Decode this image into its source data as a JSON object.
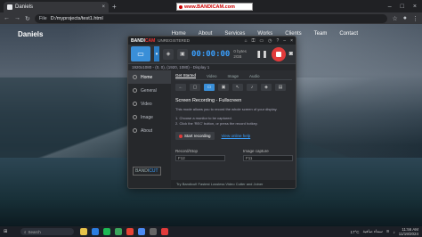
{
  "browser": {
    "tab_title": "Daniels",
    "tab_close": "×",
    "new_tab": "+",
    "window_controls": [
      "–",
      "□",
      "×"
    ],
    "address_scheme": "File",
    "address_path": "D:/myprojects/test1.html"
  },
  "website": {
    "brand": "Daniels",
    "nav": [
      "Home",
      "About",
      "Services",
      "Works",
      "Clients",
      "Team",
      "Contact"
    ]
  },
  "bandicam_banner": {
    "text": "www.BANDICAM.com"
  },
  "bandicam": {
    "logo_a": "BANDI",
    "logo_b": "CAM",
    "subtitle": "UNREGISTERED",
    "timer": "00:00:00",
    "size_value": "0 bytes",
    "size_total": "2GB",
    "info": "1920x1080 - (0, 0), (1920, 1080) - Display 1",
    "sidebar": [
      "Home",
      "General",
      "Video",
      "Image",
      "About"
    ],
    "unregistered_a": "BANDI",
    "unregistered_b": "CUT",
    "tabs": [
      "Get Started",
      "Video",
      "Image",
      "Audio"
    ],
    "heading": "Screen Recording - Fullscreen",
    "description": "This mode allows you to record the whole screen of your display.",
    "steps": [
      "1. Choose a monitor to be captured.",
      "2. Click the 'REC' button, or press the record hotkey."
    ],
    "start_button": "Start recording",
    "help_link": "View online help",
    "hotkey_record_label": "Record/Stop",
    "hotkey_record_value": "F12",
    "hotkey_capture_label": "Image capture",
    "hotkey_capture_value": "F11",
    "footer": "Try Bandicut! Fastest Lossless Video Cutter and Joiner"
  },
  "taskbar": {
    "search_placeholder": "Search",
    "temp": "17°C",
    "weather_text": "سماء صافية",
    "time": "11:56 AM",
    "date": "11/19/2024"
  },
  "colors": {
    "accent_blue": "#3a8fd8",
    "rec_red": "#e23b3b",
    "timer_blue": "#3aa0ff"
  }
}
